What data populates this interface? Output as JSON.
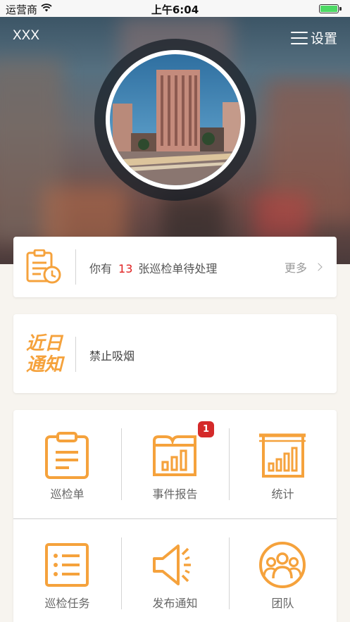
{
  "status_bar": {
    "carrier": "运营商",
    "time": "上午6:04"
  },
  "header": {
    "title": "XXX",
    "settings_label": "设置"
  },
  "todo": {
    "prefix": "你有",
    "count": "13",
    "suffix": "张巡检单待处理",
    "more_label": "更多"
  },
  "notice": {
    "logo_line1": "近日",
    "logo_line2": "通知",
    "text": "禁止吸烟"
  },
  "grid": {
    "items": [
      {
        "label": "巡检单",
        "icon": "clipboard-icon"
      },
      {
        "label": "事件报告",
        "icon": "report-chart-icon",
        "badge": "1"
      },
      {
        "label": "统计",
        "icon": "statistics-icon"
      },
      {
        "label": "巡检任务",
        "icon": "task-list-icon"
      },
      {
        "label": "发布通知",
        "icon": "speaker-icon"
      },
      {
        "label": "团队",
        "icon": "team-icon"
      }
    ]
  },
  "colors": {
    "accent": "#f5a23c",
    "badge": "#d42a2a",
    "count": "#e02020"
  }
}
